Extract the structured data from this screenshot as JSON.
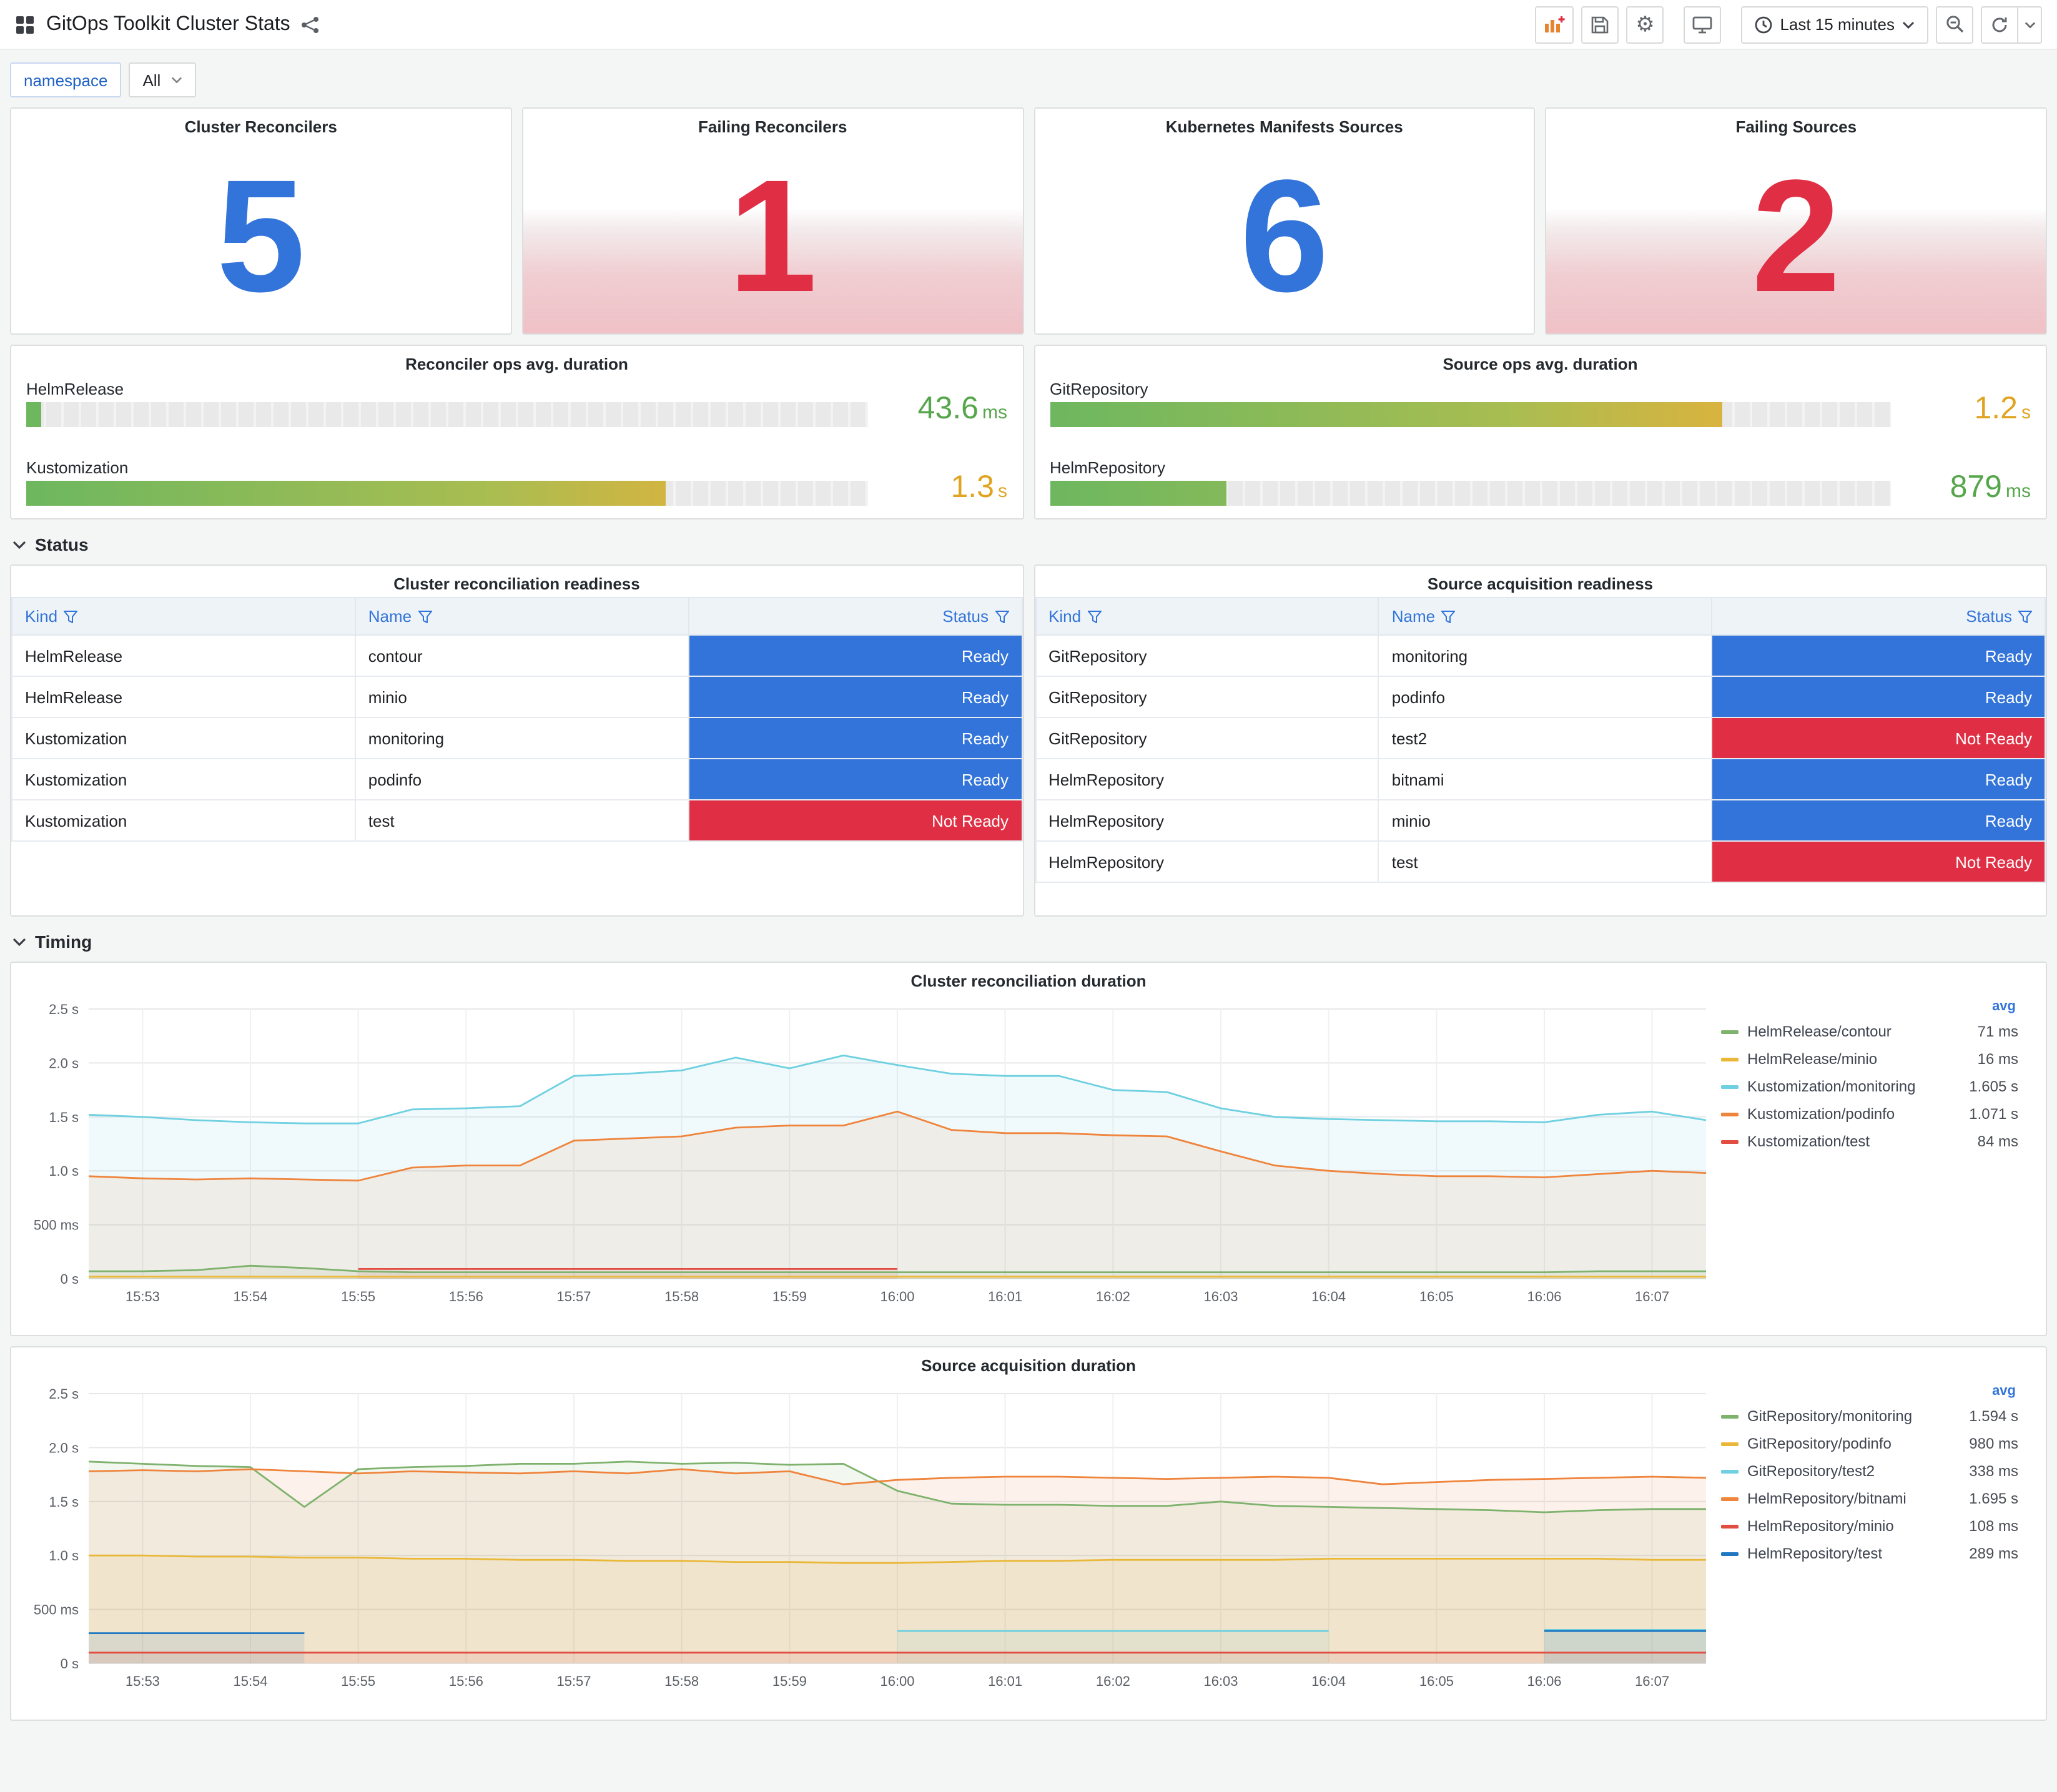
{
  "header": {
    "title": "GitOps Toolkit Cluster Stats"
  },
  "toolbar": {
    "time_range": "Last 15 minutes"
  },
  "variables": {
    "namespace_label": "namespace",
    "namespace_value": "All"
  },
  "sections": {
    "status": "Status",
    "timing": "Timing"
  },
  "stats": [
    {
      "title": "Cluster Reconcilers",
      "value": "5",
      "color": "#3274D9",
      "failing": false
    },
    {
      "title": "Failing Reconcilers",
      "value": "1",
      "color": "#E02F44",
      "failing": true
    },
    {
      "title": "Kubernetes Manifests Sources",
      "value": "6",
      "color": "#3274D9",
      "failing": false
    },
    {
      "title": "Failing Sources",
      "value": "2",
      "color": "#E02F44",
      "failing": true
    }
  ],
  "gauges": [
    {
      "title": "Reconciler ops avg. duration",
      "bars": [
        {
          "label": "HelmRelease",
          "value": "43.6",
          "unit": "ms",
          "pct": 1.8,
          "value_color": "#56A64B"
        },
        {
          "label": "Kustomization",
          "value": "1.3",
          "unit": "s",
          "pct": 76,
          "value_color": "#E0A422"
        }
      ]
    },
    {
      "title": "Source ops avg. duration",
      "bars": [
        {
          "label": "GitRepository",
          "value": "1.2",
          "unit": "s",
          "pct": 80,
          "value_color": "#E0A422"
        },
        {
          "label": "HelmRepository",
          "value": "879",
          "unit": "ms",
          "pct": 21,
          "value_color": "#56A64B"
        }
      ]
    }
  ],
  "status_colors": {
    "Ready": "#3274D9",
    "Not Ready": "#E02F44"
  },
  "tables": [
    {
      "title": "Cluster reconciliation readiness",
      "columns": [
        "Kind",
        "Name",
        "Status"
      ],
      "rows": [
        [
          "HelmRelease",
          "contour",
          "Ready"
        ],
        [
          "HelmRelease",
          "minio",
          "Ready"
        ],
        [
          "Kustomization",
          "monitoring",
          "Ready"
        ],
        [
          "Kustomization",
          "podinfo",
          "Ready"
        ],
        [
          "Kustomization",
          "test",
          "Not Ready"
        ]
      ]
    },
    {
      "title": "Source acquisition readiness",
      "columns": [
        "Kind",
        "Name",
        "Status"
      ],
      "rows": [
        [
          "GitRepository",
          "monitoring",
          "Ready"
        ],
        [
          "GitRepository",
          "podinfo",
          "Ready"
        ],
        [
          "GitRepository",
          "test2",
          "Not Ready"
        ],
        [
          "HelmRepository",
          "bitnami",
          "Ready"
        ],
        [
          "HelmRepository",
          "minio",
          "Ready"
        ],
        [
          "HelmRepository",
          "test",
          "Not Ready"
        ]
      ]
    }
  ],
  "chart_data": [
    {
      "type": "line",
      "title": "Cluster reconciliation duration",
      "ylim": [
        0,
        2.5
      ],
      "y_ticks": [
        {
          "v": 0,
          "label": "0 s"
        },
        {
          "v": 0.5,
          "label": "500 ms"
        },
        {
          "v": 1,
          "label": "1.0 s"
        },
        {
          "v": 1.5,
          "label": "1.5 s"
        },
        {
          "v": 2,
          "label": "2.0 s"
        },
        {
          "v": 2.5,
          "label": "2.5 s"
        }
      ],
      "x_tick_labels": [
        "15:53",
        "15:54",
        "15:55",
        "15:56",
        "15:57",
        "15:58",
        "15:59",
        "16:00",
        "16:01",
        "16:02",
        "16:03",
        "16:04",
        "16:05",
        "16:06",
        "16:07"
      ],
      "step_seconds": 30,
      "legend_header": "avg",
      "legend_position": "right",
      "grid": true,
      "series": [
        {
          "name": "HelmRelease/contour",
          "avg": "71 ms",
          "color": "#7EB26D",
          "values": [
            0.07,
            0.07,
            0.08,
            0.12,
            0.1,
            0.07,
            0.06,
            0.06,
            0.06,
            0.06,
            0.06,
            0.06,
            0.06,
            0.06,
            0.06,
            0.06,
            0.06,
            0.06,
            0.06,
            0.06,
            0.06,
            0.06,
            0.06,
            0.06,
            0.06,
            0.06,
            0.06,
            0.06,
            0.07,
            0.07,
            0.07
          ]
        },
        {
          "name": "HelmRelease/minio",
          "avg": "16 ms",
          "color": "#EAB839",
          "values": [
            0.02,
            0.02,
            0.02,
            0.02,
            0.02,
            0.02,
            0.02,
            0.02,
            0.02,
            0.02,
            0.02,
            0.02,
            0.02,
            0.02,
            0.02,
            0.02,
            0.02,
            0.02,
            0.02,
            0.02,
            0.02,
            0.02,
            0.02,
            0.02,
            0.02,
            0.02,
            0.02,
            0.02,
            0.02,
            0.02,
            0.02
          ]
        },
        {
          "name": "Kustomization/monitoring",
          "avg": "1.605 s",
          "color": "#6ED0E0",
          "values": [
            1.52,
            1.5,
            1.47,
            1.45,
            1.44,
            1.44,
            1.57,
            1.58,
            1.6,
            1.88,
            1.9,
            1.93,
            2.05,
            1.95,
            2.07,
            1.98,
            1.9,
            1.88,
            1.88,
            1.75,
            1.73,
            1.58,
            1.5,
            1.48,
            1.47,
            1.46,
            1.46,
            1.45,
            1.52,
            1.55,
            1.47
          ]
        },
        {
          "name": "Kustomization/podinfo",
          "avg": "1.071 s",
          "color": "#EF843C",
          "values": [
            0.95,
            0.93,
            0.92,
            0.93,
            0.92,
            0.91,
            1.03,
            1.05,
            1.05,
            1.28,
            1.3,
            1.32,
            1.4,
            1.42,
            1.42,
            1.55,
            1.38,
            1.35,
            1.35,
            1.33,
            1.32,
            1.18,
            1.05,
            1.0,
            0.97,
            0.95,
            0.95,
            0.94,
            0.97,
            1.0,
            0.98
          ]
        },
        {
          "name": "Kustomization/test",
          "avg": "84 ms",
          "color": "#E24D42",
          "values": [
            null,
            null,
            null,
            null,
            null,
            0.09,
            0.09,
            0.09,
            0.09,
            0.09,
            0.09,
            0.09,
            0.09,
            0.09,
            0.09,
            0.09,
            null,
            null,
            null,
            null,
            null,
            null,
            null,
            null,
            null,
            null,
            null,
            null,
            null,
            null,
            null
          ]
        }
      ]
    },
    {
      "type": "line",
      "title": "Source acquisition duration",
      "ylim": [
        0,
        2.5
      ],
      "y_ticks": [
        {
          "v": 0,
          "label": "0 s"
        },
        {
          "v": 0.5,
          "label": "500 ms"
        },
        {
          "v": 1,
          "label": "1.0 s"
        },
        {
          "v": 1.5,
          "label": "1.5 s"
        },
        {
          "v": 2,
          "label": "2.0 s"
        },
        {
          "v": 2.5,
          "label": "2.5 s"
        }
      ],
      "x_tick_labels": [
        "15:53",
        "15:54",
        "15:55",
        "15:56",
        "15:57",
        "15:58",
        "15:59",
        "16:00",
        "16:01",
        "16:02",
        "16:03",
        "16:04",
        "16:05",
        "16:06",
        "16:07"
      ],
      "step_seconds": 30,
      "legend_header": "avg",
      "legend_position": "right",
      "grid": true,
      "series": [
        {
          "name": "GitRepository/monitoring",
          "avg": "1.594 s",
          "color": "#7EB26D",
          "values": [
            1.87,
            1.85,
            1.83,
            1.82,
            1.45,
            1.8,
            1.82,
            1.83,
            1.85,
            1.85,
            1.87,
            1.85,
            1.86,
            1.84,
            1.85,
            1.6,
            1.48,
            1.47,
            1.47,
            1.46,
            1.46,
            1.5,
            1.46,
            1.45,
            1.44,
            1.43,
            1.42,
            1.4,
            1.42,
            1.43,
            1.43
          ]
        },
        {
          "name": "GitRepository/podinfo",
          "avg": "980 ms",
          "color": "#EAB839",
          "values": [
            1.0,
            1.0,
            0.99,
            0.99,
            0.98,
            0.98,
            0.97,
            0.97,
            0.96,
            0.96,
            0.95,
            0.95,
            0.94,
            0.94,
            0.93,
            0.93,
            0.94,
            0.95,
            0.95,
            0.96,
            0.96,
            0.96,
            0.96,
            0.97,
            0.97,
            0.97,
            0.97,
            0.97,
            0.97,
            0.96,
            0.96
          ]
        },
        {
          "name": "GitRepository/test2",
          "avg": "338 ms",
          "color": "#6ED0E0",
          "values": [
            null,
            null,
            null,
            null,
            null,
            null,
            null,
            null,
            null,
            null,
            null,
            null,
            null,
            null,
            null,
            0.3,
            0.3,
            0.3,
            0.3,
            0.3,
            0.3,
            0.3,
            0.3,
            0.3,
            null,
            null,
            null,
            0.31,
            0.31,
            0.31,
            0.31
          ]
        },
        {
          "name": "HelmRepository/bitnami",
          "avg": "1.695 s",
          "color": "#EF843C",
          "values": [
            1.78,
            1.79,
            1.78,
            1.8,
            1.78,
            1.76,
            1.78,
            1.77,
            1.76,
            1.78,
            1.76,
            1.8,
            1.76,
            1.78,
            1.66,
            1.7,
            1.72,
            1.73,
            1.73,
            1.72,
            1.71,
            1.72,
            1.73,
            1.72,
            1.66,
            1.68,
            1.7,
            1.71,
            1.72,
            1.73,
            1.72
          ]
        },
        {
          "name": "HelmRepository/minio",
          "avg": "108 ms",
          "color": "#E24D42",
          "values": [
            0.1,
            0.1,
            0.1,
            0.1,
            0.1,
            0.1,
            0.1,
            0.1,
            0.1,
            0.1,
            0.1,
            0.1,
            0.1,
            0.1,
            0.1,
            0.1,
            0.1,
            0.1,
            0.1,
            0.1,
            0.1,
            0.1,
            0.1,
            0.1,
            0.1,
            0.1,
            0.1,
            0.1,
            0.1,
            0.1,
            0.1
          ]
        },
        {
          "name": "HelmRepository/test",
          "avg": "289 ms",
          "color": "#1F78C1",
          "values": [
            0.28,
            0.28,
            0.28,
            0.28,
            0.28,
            null,
            null,
            null,
            null,
            null,
            null,
            null,
            null,
            null,
            null,
            null,
            null,
            null,
            null,
            null,
            null,
            null,
            null,
            null,
            null,
            null,
            null,
            0.3,
            0.3,
            0.3,
            0.3
          ]
        }
      ]
    }
  ]
}
